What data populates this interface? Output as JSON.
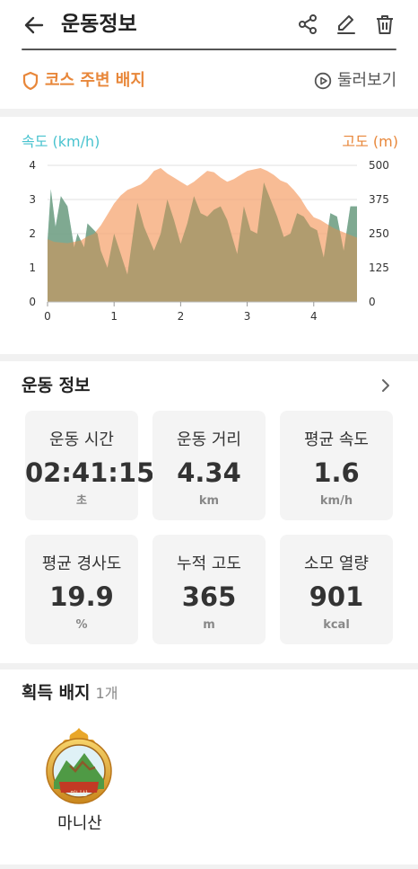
{
  "appbar": {
    "title": "운동정보",
    "icons": [
      "back-arrow-icon",
      "share-icon",
      "edit-icon",
      "trash-icon"
    ]
  },
  "course": {
    "badge_label": "코스 주변 배지",
    "browse_label": "둘러보기",
    "accent": "#e8873a"
  },
  "chart": {
    "left_label": "속도 (km/h)",
    "right_label": "고도 (m)"
  },
  "chart_data": {
    "type": "area",
    "x_ticks": [
      "0",
      "1",
      "2",
      "3",
      "4"
    ],
    "xlim": [
      0,
      4.65
    ],
    "y_left": {
      "label": "속도 (km/h)",
      "ticks": [
        "4",
        "3",
        "2",
        "1",
        "0"
      ],
      "ylim": [
        0,
        4
      ],
      "color": "#49c3cf"
    },
    "y_right": {
      "label": "고도 (m)",
      "ticks": [
        "500",
        "375",
        "250",
        "125",
        "0"
      ],
      "ylim": [
        0,
        500
      ],
      "color": "#f5a571"
    },
    "grid": true,
    "series": [
      {
        "axis": "left",
        "x": [
          0,
          0.05,
          0.12,
          0.2,
          0.3,
          0.4,
          0.45,
          0.55,
          0.6,
          0.75,
          0.8,
          0.9,
          1.0,
          1.1,
          1.2,
          1.35,
          1.45,
          1.6,
          1.7,
          1.8,
          1.9,
          2.0,
          2.1,
          2.2,
          2.3,
          2.4,
          2.5,
          2.6,
          2.7,
          2.85,
          2.95,
          3.05,
          3.15,
          3.25,
          3.35,
          3.45,
          3.55,
          3.65,
          3.75,
          3.85,
          3.95,
          4.05,
          4.15,
          4.25,
          4.35,
          4.45,
          4.55,
          4.65
        ],
        "y": [
          1.8,
          3.3,
          2.2,
          3.1,
          2.8,
          1.6,
          2.0,
          1.6,
          2.3,
          2.0,
          1.5,
          1.0,
          2.0,
          1.4,
          0.8,
          2.9,
          2.2,
          1.5,
          2.0,
          3.0,
          2.4,
          1.7,
          2.3,
          3.1,
          2.6,
          2.5,
          2.7,
          2.8,
          2.4,
          1.4,
          2.8,
          2.1,
          2.0,
          3.5,
          3.0,
          2.5,
          1.9,
          2.0,
          2.6,
          2.5,
          2.2,
          2.1,
          1.3,
          2.6,
          2.5,
          1.5,
          2.8,
          2.8
        ]
      },
      {
        "axis": "right",
        "x": [
          0,
          0.1,
          0.3,
          0.5,
          0.6,
          0.7,
          0.8,
          0.9,
          1.0,
          1.1,
          1.2,
          1.3,
          1.4,
          1.5,
          1.6,
          1.7,
          1.8,
          1.9,
          2.0,
          2.1,
          2.2,
          2.3,
          2.4,
          2.5,
          2.6,
          2.7,
          2.8,
          2.9,
          3.0,
          3.1,
          3.2,
          3.3,
          3.4,
          3.5,
          3.6,
          3.7,
          3.8,
          3.9,
          4.0,
          4.1,
          4.2,
          4.3,
          4.4,
          4.5,
          4.6,
          4.65
        ],
        "y": [
          230,
          220,
          215,
          225,
          240,
          250,
          280,
          320,
          360,
          390,
          410,
          420,
          430,
          450,
          480,
          490,
          470,
          455,
          440,
          425,
          440,
          460,
          480,
          475,
          455,
          440,
          450,
          465,
          480,
          485,
          490,
          480,
          465,
          445,
          435,
          410,
          380,
          340,
          310,
          300,
          285,
          270,
          260,
          250,
          240,
          235
        ]
      }
    ]
  },
  "exercise": {
    "heading": "운동 정보",
    "cards": [
      {
        "label": "운동 시간",
        "value": "02:41:15",
        "unit": "초"
      },
      {
        "label": "운동 거리",
        "value": "4.34",
        "unit": "km"
      },
      {
        "label": "평균 속도",
        "value": "1.6",
        "unit": "km/h"
      },
      {
        "label": "평균 경사도",
        "value": "19.9",
        "unit": "%"
      },
      {
        "label": "누적 고도",
        "value": "365",
        "unit": "m"
      },
      {
        "label": "소모 열량",
        "value": "901",
        "unit": "kcal"
      }
    ]
  },
  "badges": {
    "heading": "획득 배지",
    "count": "1개",
    "items": [
      {
        "name": "마니산",
        "seal_text": "마니산"
      }
    ]
  }
}
